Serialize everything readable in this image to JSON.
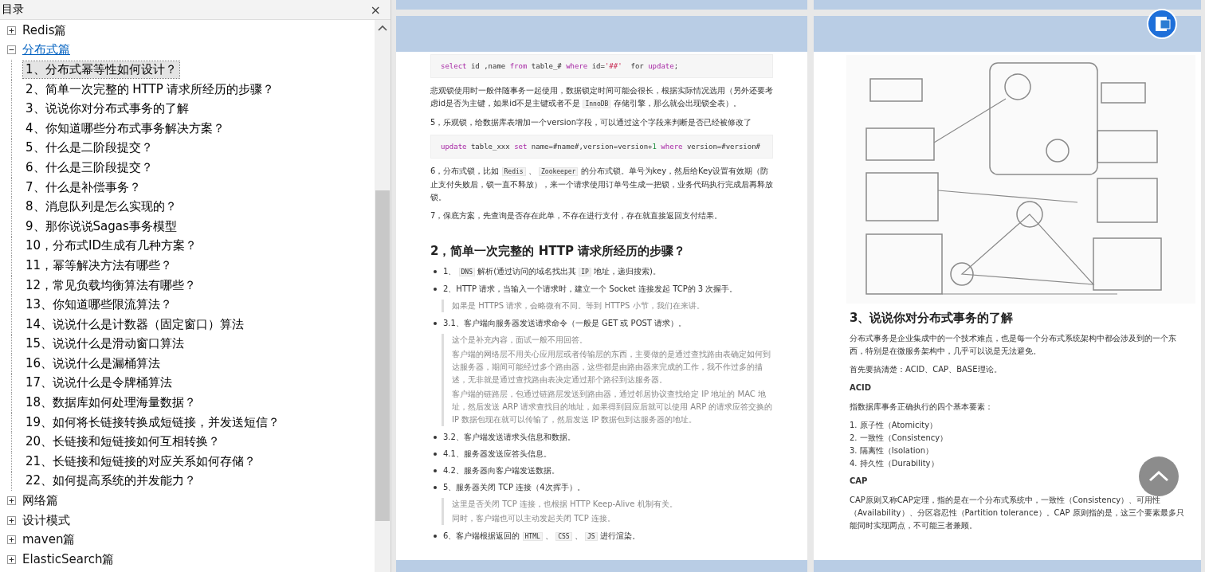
{
  "sidebar": {
    "title": "目录",
    "close": "×",
    "tree": [
      {
        "label": "Redis篇",
        "expanded": false,
        "active": false
      },
      {
        "label": "分布式篇",
        "expanded": true,
        "active": true,
        "children": [
          {
            "label": "1、分布式幂等性如何设计？",
            "selected": true
          },
          {
            "label": "2、简单一次完整的 HTTP 请求所经历的步骤？",
            "selected": false
          },
          {
            "label": "3、说说你对分布式事务的了解",
            "selected": false
          },
          {
            "label": "4、你知道哪些分布式事务解决方案？",
            "selected": false
          },
          {
            "label": "5、什么是二阶段提交？",
            "selected": false
          },
          {
            "label": "6、什么是三阶段提交？",
            "selected": false
          },
          {
            "label": "7、什么是补偿事务？",
            "selected": false
          },
          {
            "label": "8、消息队列是怎么实现的？",
            "selected": false
          },
          {
            "label": "9、那你说说Sagas事务模型",
            "selected": false
          },
          {
            "label": "10，分布式ID生成有几种方案？",
            "selected": false
          },
          {
            "label": "11，幂等解决方法有哪些？",
            "selected": false
          },
          {
            "label": "12，常见负载均衡算法有哪些？",
            "selected": false
          },
          {
            "label": "13、你知道哪些限流算法？",
            "selected": false
          },
          {
            "label": "14、说说什么是计数器（固定窗口）算法",
            "selected": false
          },
          {
            "label": "15、说说什么是滑动窗口算法",
            "selected": false
          },
          {
            "label": "16、说说什么是漏桶算法",
            "selected": false
          },
          {
            "label": "17、说说什么是令牌桶算法",
            "selected": false
          },
          {
            "label": "18、数据库如何处理海量数据？",
            "selected": false
          },
          {
            "label": "19、如何将长链接转换成短链接，并发送短信？",
            "selected": false
          },
          {
            "label": "20、长链接和短链接如何互相转换？",
            "selected": false
          },
          {
            "label": "21、长链接和短链接的对应关系如何存储？",
            "selected": false
          },
          {
            "label": "22、如何提高系统的并发能力？",
            "selected": false
          }
        ]
      },
      {
        "label": "网络篇",
        "expanded": false,
        "active": false
      },
      {
        "label": "设计模式",
        "expanded": false,
        "active": false
      },
      {
        "label": "maven篇",
        "expanded": false,
        "active": false
      },
      {
        "label": "ElasticSearch篇",
        "expanded": false,
        "active": false
      }
    ]
  },
  "pages": [
    {
      "blocks": [
        {
          "kind": "code",
          "tokens": [
            {
              "kind": "kw",
              "text": "select"
            },
            {
              "kind": "plain",
              "text": " id ,name "
            },
            {
              "kind": "kw",
              "text": "from"
            },
            {
              "kind": "plain",
              "text": " table_# "
            },
            {
              "kind": "kw",
              "text": "where"
            },
            {
              "kind": "plain",
              "text": " id="
            },
            {
              "kind": "str",
              "text": "'##'"
            },
            {
              "kind": "plain",
              "text": "  for "
            },
            {
              "kind": "kw",
              "text": "update"
            },
            {
              "kind": "plain",
              "text": ";"
            }
          ]
        },
        {
          "kind": "p",
          "parts": [
            {
              "kind": "text",
              "text": "悲观锁使用时一般伴随事务一起使用，数据锁定时间可能会很长，根据实际情况选用（另外还要考虑id是否为主键，如果id不是主键或者不是 "
            },
            {
              "kind": "code",
              "text": "InnoDB"
            },
            {
              "kind": "text",
              "text": " 存储引擎，那么就会出现锁全表）。"
            }
          ]
        },
        {
          "kind": "p",
          "parts": [
            {
              "kind": "text",
              "text": "5，乐观锁，给数据库表增加一个version字段，可以通过这个字段来判断是否已经被修改了"
            }
          ]
        },
        {
          "kind": "code",
          "tokens": [
            {
              "kind": "kw",
              "text": "update"
            },
            {
              "kind": "plain",
              "text": " table_xxx "
            },
            {
              "kind": "kw",
              "text": "set"
            },
            {
              "kind": "plain",
              "text": " name=#name#,version=version+"
            },
            {
              "kind": "num",
              "text": "1"
            },
            {
              "kind": "kw",
              "text": " where"
            },
            {
              "kind": "plain",
              "text": " version=#version#"
            }
          ]
        },
        {
          "kind": "p",
          "parts": [
            {
              "kind": "text",
              "text": "6，分布式锁，比如 "
            },
            {
              "kind": "code",
              "text": "Redis"
            },
            {
              "kind": "text",
              "text": " 、 "
            },
            {
              "kind": "code",
              "text": "Zookeeper"
            },
            {
              "kind": "text",
              "text": " 的分布式锁。单号为key，然后给Key设置有效期（防止支付失败后，锁一直不释放），来一个请求使用订单号生成一把锁，业务代码执行完成后再释放锁。"
            }
          ]
        },
        {
          "kind": "p",
          "parts": [
            {
              "kind": "text",
              "text": "7，保底方案，先查询是否存在此单，不存在进行支付，存在就直接返回支付结果。"
            }
          ]
        },
        {
          "kind": "h2",
          "text": "2，简单一次完整的 HTTP 请求所经历的步骤？"
        },
        {
          "kind": "li",
          "parts": [
            {
              "kind": "text",
              "text": "1、 "
            },
            {
              "kind": "code",
              "text": "DNS"
            },
            {
              "kind": "text",
              "text": " 解析(通过访问的域名找出其 "
            },
            {
              "kind": "code",
              "text": "IP"
            },
            {
              "kind": "text",
              "text": " 地址，递归搜索)。"
            }
          ]
        },
        {
          "kind": "li",
          "parts": [
            {
              "kind": "text",
              "text": "2、HTTP 请求，当输入一个请求时，建立一个 Socket 连接发起 TCP的 3 次握手。"
            }
          ]
        },
        {
          "kind": "quote",
          "lines": [
            "如果是 HTTPS 请求，会略微有不同。等到 HTTPS 小节，我们在来讲。"
          ]
        },
        {
          "kind": "li",
          "parts": [
            {
              "kind": "text",
              "text": "3.1、客户端向服务器发送请求命令（一般是 GET 或 POST 请求）。"
            }
          ]
        },
        {
          "kind": "quote",
          "lines": [
            "这个是补充内容，面试一般不用回答。",
            "客户端的网络层不用关心应用层或者传输层的东西，主要做的是通过查找路由表确定如何到达服务器，期间可能经过多个路由器，这些都是由路由器来完成的工作，我不作过多的描述，无非就是通过查找路由表决定通过那个路径到达服务器。",
            "客户端的链路层，包通过链路层发送到路由器，通过邻居协议查找给定 IP 地址的 MAC 地址，然后发送 ARP 请求查找目的地址，如果得到回应后就可以使用 ARP 的请求应答交换的 IP 数据包现在就可以传输了，然后发送 IP 数据包到达服务器的地址。"
          ]
        },
        {
          "kind": "li",
          "parts": [
            {
              "kind": "text",
              "text": "3.2、客户端发送请求头信息和数据。"
            }
          ]
        },
        {
          "kind": "li",
          "parts": [
            {
              "kind": "text",
              "text": "4.1、服务器发送应答头信息。"
            }
          ]
        },
        {
          "kind": "li",
          "parts": [
            {
              "kind": "text",
              "text": "4.2、服务器向客户端发送数据。"
            }
          ]
        },
        {
          "kind": "li",
          "parts": [
            {
              "kind": "text",
              "text": "5、服务器关闭 TCP 连接（4次挥手）。"
            }
          ]
        },
        {
          "kind": "quote",
          "lines": [
            "这里是否关闭 TCP 连接，也根据 HTTP Keep-Alive 机制有关。",
            "同时，客户端也可以主动发起关闭 TCP 连接。"
          ]
        },
        {
          "kind": "li",
          "parts": [
            {
              "kind": "text",
              "text": "6、客户端根据返回的 "
            },
            {
              "kind": "code",
              "text": "HTML"
            },
            {
              "kind": "text",
              "text": " 、 "
            },
            {
              "kind": "code",
              "text": "CSS"
            },
            {
              "kind": "text",
              "text": " 、 "
            },
            {
              "kind": "code",
              "text": "JS"
            },
            {
              "kind": "text",
              "text": " 进行渲染。"
            }
          ]
        }
      ]
    },
    {
      "blocks": [
        {
          "kind": "picture"
        },
        {
          "kind": "h2",
          "text": "3、说说你对分布式事务的了解"
        },
        {
          "kind": "p",
          "parts": [
            {
              "kind": "text",
              "text": "分布式事务是企业集成中的一个技术难点，也是每一个分布式系统架构中都会涉及到的一个东西，特别是在微服务架构中，几乎可以说是无法避免。"
            }
          ]
        },
        {
          "kind": "p",
          "parts": [
            {
              "kind": "text",
              "text": "首先要搞清楚：ACID、CAP、BASE理论。"
            }
          ]
        },
        {
          "kind": "h3",
          "text": "ACID"
        },
        {
          "kind": "p",
          "parts": [
            {
              "kind": "text",
              "text": "指数据库事务正确执行的四个基本要素："
            }
          ]
        },
        {
          "kind": "ol",
          "items": [
            "1. 原子性（Atomicity）",
            "2. 一致性（Consistency）",
            "3. 隔离性（Isolation）",
            "4. 持久性（Durability）"
          ]
        },
        {
          "kind": "h3",
          "text": "CAP"
        },
        {
          "kind": "p",
          "parts": [
            {
              "kind": "text",
              "text": "CAP原则又称CAP定理，指的是在一个分布式系统中，一致性（Consistency）、可用性（Availability）、分区容忍性（Partition tolerance）。CAP 原则指的是，这三个要素最多只能同时实现两点，不可能三者兼顾。"
            }
          ]
        }
      ]
    }
  ]
}
